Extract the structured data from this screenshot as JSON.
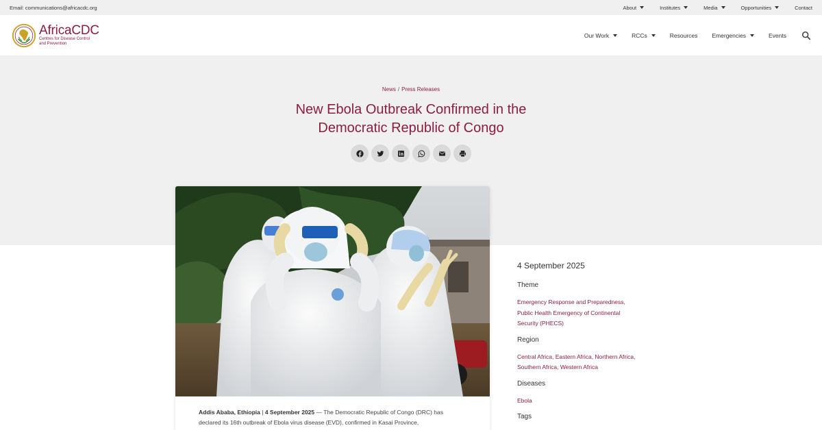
{
  "topbar": {
    "email_label": "Email: ",
    "email": "communications@africacdc.org",
    "nav": [
      {
        "label": "About",
        "dropdown": true
      },
      {
        "label": "Institutes",
        "dropdown": true
      },
      {
        "label": "Media",
        "dropdown": true
      },
      {
        "label": "Opportunities",
        "dropdown": true
      },
      {
        "label": "Contact",
        "dropdown": false
      }
    ]
  },
  "header": {
    "logo_name": "AfricaCDC",
    "logo_sub_1": "Centres for Disease Control",
    "logo_sub_2": "and Prevention",
    "nav": [
      {
        "label": "Our Work",
        "dropdown": true
      },
      {
        "label": "RCCs",
        "dropdown": true
      },
      {
        "label": "Resources",
        "dropdown": false
      },
      {
        "label": "Emergencies",
        "dropdown": true
      },
      {
        "label": "Events",
        "dropdown": false
      }
    ],
    "search_icon": "search-icon"
  },
  "article": {
    "breadcrumb": [
      "News",
      "Press Releases"
    ],
    "breadcrumb_sep": "/",
    "title": "New Ebola Outbreak Confirmed in the Democratic Republic of Congo",
    "share_icons": [
      "facebook-icon",
      "twitter-icon",
      "linkedin-icon",
      "whatsapp-icon",
      "envelope-icon",
      "print-icon"
    ],
    "lead_location": "Addis Ababa, Ethiopia",
    "lead_sep": " | ",
    "lead_date": "4 September 2025",
    "lead_text_1": " — The Democratic Republic of Congo (DRC) has",
    "lead_text_2": "declared its 16th outbreak of Ebola virus disease (EVD), confirmed in Kasai Province,"
  },
  "sidebar": {
    "date": "4 September 2025",
    "theme_heading": "Theme",
    "theme_links": [
      "Emergency Response and Preparedness",
      "Public Health Emergency of Continental Security (PHECS)"
    ],
    "region_heading": "Region",
    "region_links": [
      "Central Africa",
      "Eastern Africa",
      "Northern Africa",
      "Southern Africa",
      "Western Africa"
    ],
    "diseases_heading": "Diseases",
    "disease_links": [
      "Ebola"
    ],
    "tags_heading": "Tags"
  },
  "colors": {
    "brand": "#8b1e3f",
    "hero_bg": "#f0f0f0",
    "share_bg": "#d9d9d9"
  }
}
